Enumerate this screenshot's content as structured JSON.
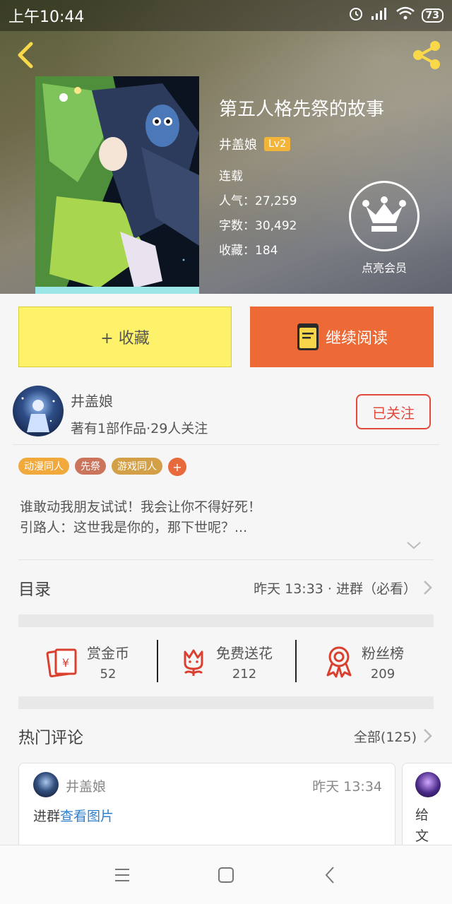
{
  "status_bar": {
    "time": "上午10:44",
    "battery": "73"
  },
  "book": {
    "title": "第五人格先祭的故事",
    "author": "井盖娘",
    "author_level": "Lv2",
    "status": "连载",
    "popularity": "人气：27,259",
    "word_count": "字数：30,492",
    "collections": "收藏：184",
    "vip_label": "点亮会员"
  },
  "actions": {
    "collect": "+ 收藏",
    "read": "继续阅读"
  },
  "author_section": {
    "name": "井盖娘",
    "meta": "著有1部作品·29人关注",
    "follow": "已关注"
  },
  "tags": [
    {
      "label": "动漫同人",
      "color": "#f2a93b"
    },
    {
      "label": "先祭",
      "color": "#c9745b"
    },
    {
      "label": "游戏同人",
      "color": "#d3a047"
    }
  ],
  "tag_add": "+",
  "description": {
    "line1": "谁敢动我朋友试试！我会让你不得好死！",
    "line2": "引路人：这世我是你的，那下世呢？..."
  },
  "toc": {
    "label": "目录",
    "latest": "昨天 13:33 · 进群（必看）"
  },
  "stats": [
    {
      "label": "赏金币",
      "value": "52"
    },
    {
      "label": "免费送花",
      "value": "212"
    },
    {
      "label": "粉丝榜",
      "value": "209"
    }
  ],
  "comments_section": {
    "label": "热门评论",
    "all": "全部(125)"
  },
  "comments": [
    {
      "name": "井盖娘",
      "time": "昨天 13:34",
      "text": "进群",
      "link": "查看图片"
    }
  ],
  "comment_peek": {
    "line1": "给",
    "line2": "文"
  }
}
